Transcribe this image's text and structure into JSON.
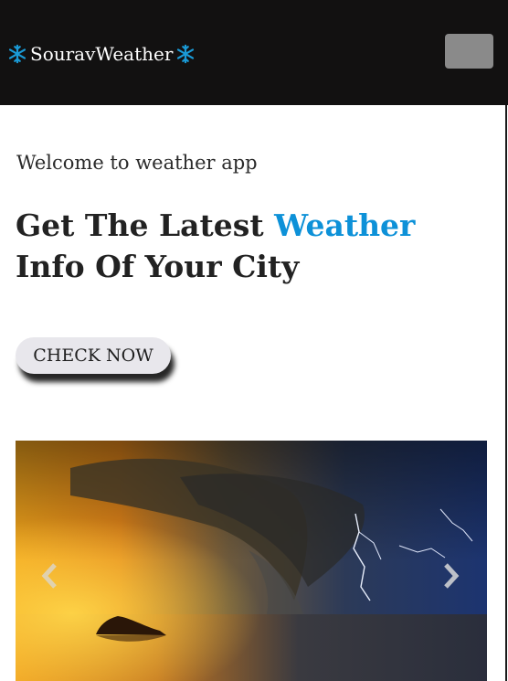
{
  "navbar": {
    "brand_label": "SouravWeather"
  },
  "hero": {
    "welcome_text": "Welcome to weather app",
    "headline_pre": "Get The Latest ",
    "headline_accent": "Weather",
    "headline_post": " Info Of Your City",
    "cta_label": "CHECK NOW"
  },
  "carousel": {
    "image": "storm-over-sea-image",
    "prev_icon": "chevron-left-icon",
    "next_icon": "chevron-right-icon"
  },
  "colors": {
    "navbar_bg": "#121111",
    "accent": "#0d91d8",
    "snowflake": "#1a9ad6",
    "button_bg": "#e8e7ec"
  }
}
